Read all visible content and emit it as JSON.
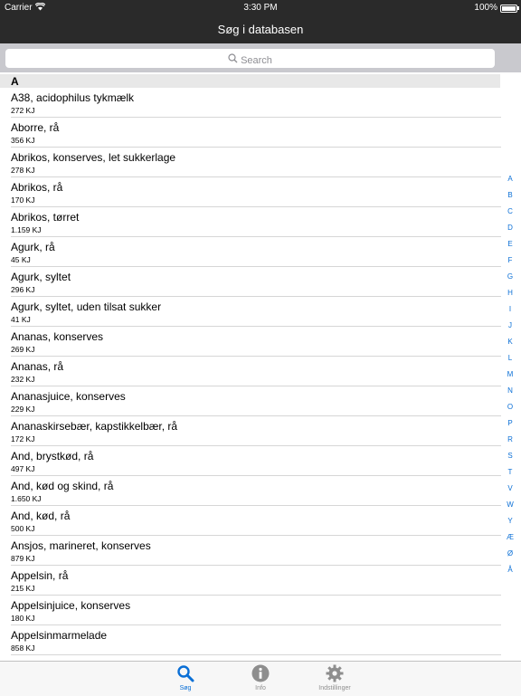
{
  "status_bar": {
    "carrier": "Carrier",
    "time": "3:30 PM",
    "battery": "100%"
  },
  "nav": {
    "title": "Søg i databasen"
  },
  "search": {
    "placeholder": "Search"
  },
  "section": {
    "letter": "A"
  },
  "items": [
    {
      "name": "A38, acidophilus tykmælk",
      "energy": "272 KJ"
    },
    {
      "name": "Aborre, rå",
      "energy": "356 KJ"
    },
    {
      "name": "Abrikos, konserves, let sukkerlage",
      "energy": "278 KJ"
    },
    {
      "name": "Abrikos, rå",
      "energy": "170 KJ"
    },
    {
      "name": "Abrikos, tørret",
      "energy": "1.159 KJ"
    },
    {
      "name": "Agurk, rå",
      "energy": "45 KJ"
    },
    {
      "name": "Agurk, syltet",
      "energy": "296 KJ"
    },
    {
      "name": "Agurk, syltet, uden tilsat sukker",
      "energy": "41 KJ"
    },
    {
      "name": "Ananas, konserves",
      "energy": "269 KJ"
    },
    {
      "name": "Ananas, rå",
      "energy": "232 KJ"
    },
    {
      "name": "Ananasjuice, konserves",
      "energy": "229 KJ"
    },
    {
      "name": "Ananaskirsebær, kapstikkelbær, rå",
      "energy": "172 KJ"
    },
    {
      "name": "And, brystkød, rå",
      "energy": "497 KJ"
    },
    {
      "name": "And, kød og skind, rå",
      "energy": "1.650 KJ"
    },
    {
      "name": "And, kød, rå",
      "energy": "500 KJ"
    },
    {
      "name": "Ansjos, marineret, konserves",
      "energy": "879 KJ"
    },
    {
      "name": "Appelsin, rå",
      "energy": "215 KJ"
    },
    {
      "name": "Appelsinjuice, konserves",
      "energy": "180 KJ"
    },
    {
      "name": "Appelsinmarmelade",
      "energy": "858 KJ"
    }
  ],
  "index_letters": [
    "A",
    "B",
    "C",
    "D",
    "E",
    "F",
    "G",
    "H",
    "I",
    "J",
    "K",
    "L",
    "M",
    "N",
    "O",
    "P",
    "R",
    "S",
    "T",
    "V",
    "W",
    "Y",
    "Æ",
    "Ø",
    "Å"
  ],
  "tabs": [
    {
      "label": "Søg",
      "icon": "search-icon",
      "active": true
    },
    {
      "label": "Info",
      "icon": "info-icon",
      "active": false
    },
    {
      "label": "Indstillinger",
      "icon": "gear-icon",
      "active": false
    }
  ],
  "colors": {
    "accent": "#0a6fd6",
    "bar": "#2a2a2a",
    "search_bg": "#c9c9ce"
  }
}
